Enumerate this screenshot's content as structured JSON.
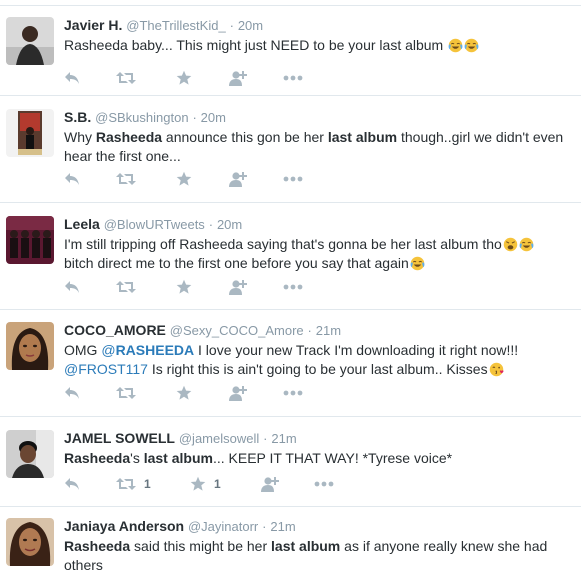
{
  "colors": {
    "icon": "#aab8c2",
    "handle": "#8899a6",
    "link": "#2b7bb9",
    "text": "#292f33",
    "separator": "#e1e8ed"
  },
  "icons": {
    "reply": "reply-icon",
    "retweet": "retweet-icon",
    "favorite": "star-icon",
    "follow": "follow-icon",
    "more": "more-icon"
  },
  "tweets": [
    {
      "name": "Javier H.",
      "handle": "@TheTrillestKid_",
      "dot": "·",
      "time": "20m",
      "text": [
        {
          "t": "Rasheeda baby... This might just NEED to be your last album "
        },
        {
          "emoji": "tears-of-joy"
        },
        {
          "emoji": "tears-of-joy"
        }
      ]
    },
    {
      "name": "S.B.",
      "handle": "@SBkushington",
      "dot": "·",
      "time": "20m",
      "text": [
        {
          "t": "Why "
        },
        {
          "b": "Rasheeda"
        },
        {
          "t": " announce this gon be her "
        },
        {
          "b": "last album"
        },
        {
          "t": " though..girl we didn't even hear the first one..."
        }
      ]
    },
    {
      "name": "Leela",
      "handle": "@BlowURTweets",
      "dot": "·",
      "time": "20m",
      "text": [
        {
          "t": "I'm still tripping off Rasheeda saying that's gonna be her last album tho"
        },
        {
          "emoji": "weary"
        },
        {
          "emoji": "tears-of-joy"
        },
        {
          "br": true
        },
        {
          "t": "bitch direct me to the first one before you say that again"
        },
        {
          "emoji": "tears-of-joy"
        }
      ]
    },
    {
      "name": "COCO_AMORE",
      "handle": "@Sexy_COCO_Amore",
      "dot": "·",
      "time": "21m",
      "text": [
        {
          "t": "OMG "
        },
        {
          "m": "@",
          "bold": false
        },
        {
          "m": "RASHEEDA",
          "bold": true
        },
        {
          "t": "  I love your new Track I'm downloading it right now!!!"
        },
        {
          "br": true
        },
        {
          "m": "@FROST117",
          "bold": false
        },
        {
          "t": " Is right this is ain't going to be your last album.. Kisses"
        },
        {
          "emoji": "kiss"
        }
      ]
    },
    {
      "name": "JAMEL SOWELL",
      "handle": "@jamelsowell",
      "dot": "·",
      "time": "21m",
      "text": [
        {
          "b": "Rasheeda"
        },
        {
          "t": "'s "
        },
        {
          "b": "last album"
        },
        {
          "t": "... KEEP IT THAT WAY! *Tyrese voice*"
        }
      ],
      "retweet_count": "1",
      "favorite_count": "1"
    },
    {
      "name": "Janiaya Anderson",
      "handle": "@Jayinatorr",
      "dot": "·",
      "time": "21m",
      "text": [
        {
          "b": "Rasheeda"
        },
        {
          "t": " said this might be her "
        },
        {
          "b": "last album"
        },
        {
          "t": " as if anyone really knew she had others"
        }
      ]
    }
  ]
}
